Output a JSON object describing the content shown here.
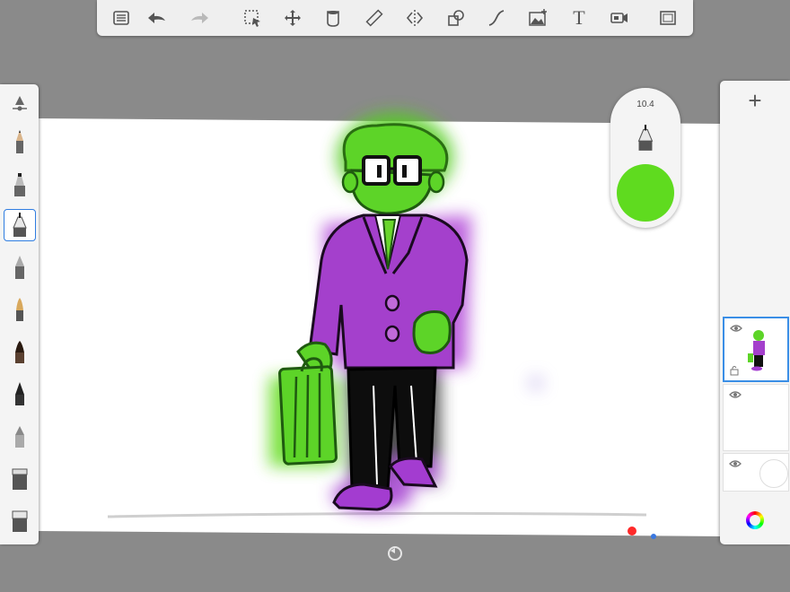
{
  "toolbar": {
    "buttons": [
      {
        "name": "layers-list-icon",
        "enabled": true
      },
      {
        "name": "undo-icon",
        "enabled": true
      },
      {
        "name": "redo-icon",
        "enabled": false
      },
      {
        "name": "selection-icon",
        "enabled": true
      },
      {
        "name": "transform-icon",
        "enabled": true
      },
      {
        "name": "fill-icon",
        "enabled": true
      },
      {
        "name": "ruler-icon",
        "enabled": true
      },
      {
        "name": "symmetry-icon",
        "enabled": true
      },
      {
        "name": "shapes-icon",
        "enabled": true
      },
      {
        "name": "curve-icon",
        "enabled": true
      },
      {
        "name": "image-icon",
        "enabled": true
      },
      {
        "name": "text-icon",
        "enabled": true
      },
      {
        "name": "record-icon",
        "enabled": true
      },
      {
        "name": "fullscreen-icon",
        "enabled": true
      }
    ],
    "text_button_glyph": "T"
  },
  "brushes": [
    {
      "name": "pencil",
      "selected": false
    },
    {
      "name": "marker",
      "selected": false
    },
    {
      "name": "ink-pen",
      "selected": true
    },
    {
      "name": "airbrush",
      "selected": false
    },
    {
      "name": "paint-brush",
      "selected": false
    },
    {
      "name": "flat-brush",
      "selected": false
    },
    {
      "name": "fine-brush",
      "selected": false
    },
    {
      "name": "soft-eraser",
      "selected": false
    },
    {
      "name": "smudge",
      "selected": false
    },
    {
      "name": "eraser",
      "selected": false
    }
  ],
  "brush_puck": {
    "size": "10.4",
    "color": "#5fdb1f"
  },
  "layers": {
    "add_label": "+",
    "items": [
      {
        "name": "layer-1",
        "selected": true,
        "visible": true
      },
      {
        "name": "layer-2",
        "selected": false,
        "visible": true
      },
      {
        "name": "background",
        "selected": false,
        "visible": true
      }
    ]
  },
  "colors": {
    "accent": "#2f7de1",
    "green": "#5fdb1f",
    "purple": "#a13cc8",
    "canvas": "#ffffff",
    "workspace": "#8a8a8a"
  }
}
